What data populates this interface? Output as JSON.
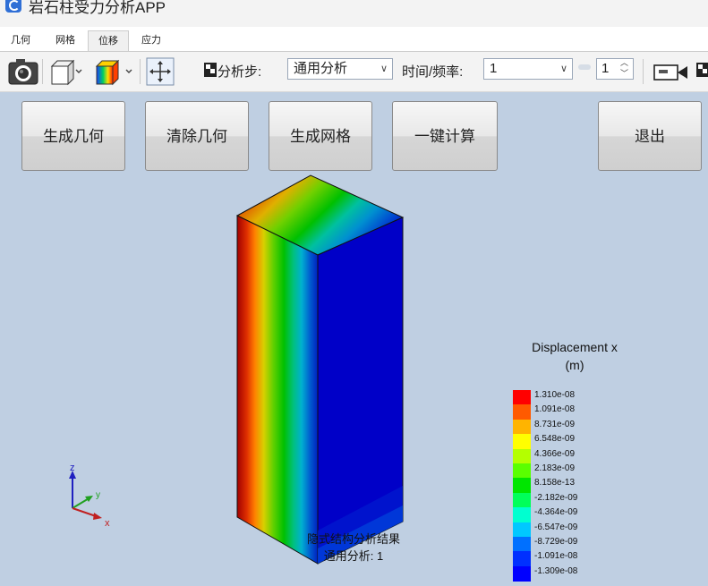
{
  "app": {
    "title": "岩石柱受力分析APP"
  },
  "menu": {
    "tabs": [
      {
        "label": "几何"
      },
      {
        "label": "网格"
      },
      {
        "label": "位移"
      },
      {
        "label": "应力"
      }
    ]
  },
  "toolbar": {
    "icons": [
      "camera-icon",
      "cube-view-icon",
      "color-map-icon",
      "move-icon",
      "step-icon",
      "video-icon"
    ],
    "step_label": "分析步:",
    "step_value": "通用分析",
    "time_label": "时间/频率:",
    "time_value": "1",
    "spin_value": "1"
  },
  "buttons": {
    "generate_geometry": "生成几何",
    "clear_geometry": "清除几何",
    "generate_mesh": "生成网格",
    "one_click_compute": "一键计算",
    "exit": "退出"
  },
  "axis_triad": {
    "z": "z",
    "y": "y",
    "x": "x"
  },
  "legend": {
    "title_line1": "Displacement x",
    "title_line2": "(m)",
    "labels": [
      "1.310e-08",
      "1.091e-08",
      "8.731e-09",
      "6.548e-09",
      "4.366e-09",
      "2.183e-09",
      "8.158e-13",
      "-2.182e-09",
      "-4.364e-09",
      "-6.547e-09",
      "-8.729e-09",
      "-1.091e-08",
      "-1.309e-08"
    ],
    "colors": [
      "#ff0000",
      "#ff5a00",
      "#ffb400",
      "#ffff00",
      "#b4ff00",
      "#5aff00",
      "#00e600",
      "#00ff5a",
      "#00ffd0",
      "#00c8ff",
      "#0070ff",
      "#0030ff",
      "#0000ff"
    ]
  },
  "result": {
    "line1": "隐式结构分析结果",
    "line2": "通用分析: 1"
  }
}
